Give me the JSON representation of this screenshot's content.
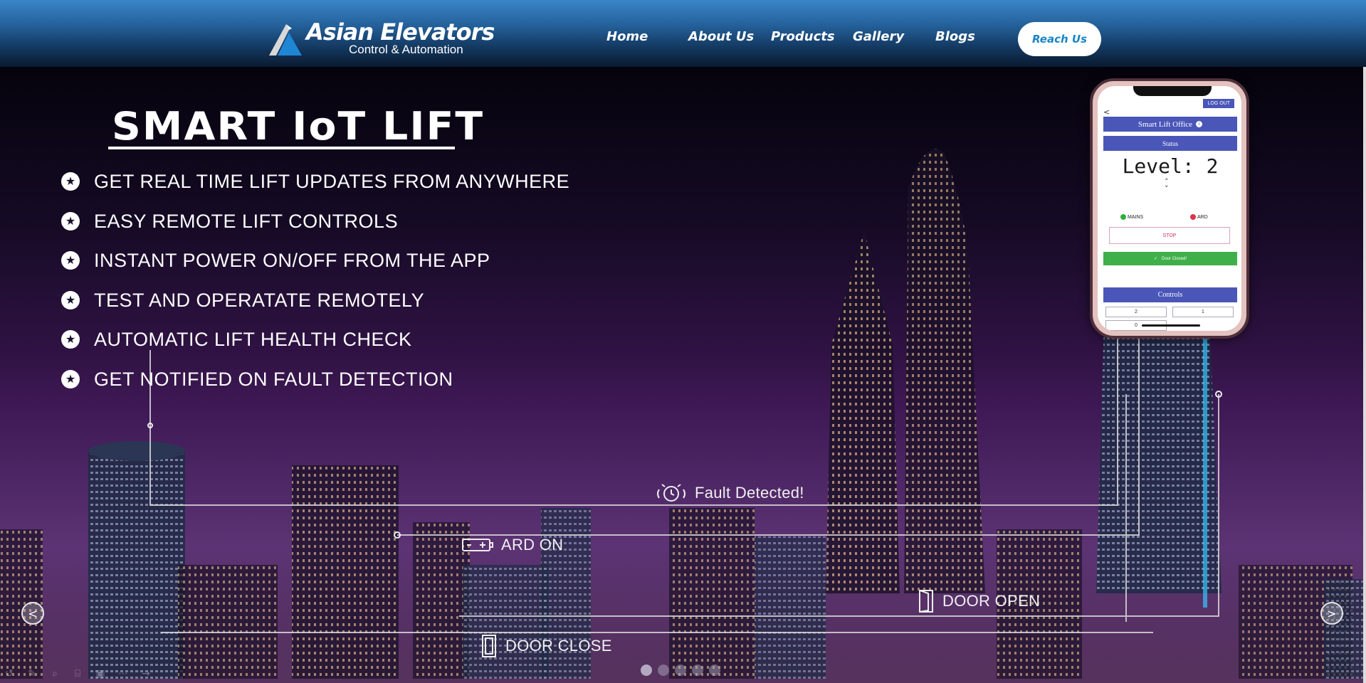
{
  "brand": {
    "name": "Asian Elevators",
    "tagline": "Control & Automation"
  },
  "nav": {
    "items": [
      {
        "label": "Home"
      },
      {
        "label": "About Us"
      },
      {
        "label": "Products"
      },
      {
        "label": "Gallery"
      },
      {
        "label": "Blogs"
      }
    ],
    "cta_label": "Reach Us"
  },
  "hero": {
    "title": "SMART IoT LIFT",
    "features": [
      "GET REAL TIME LIFT UPDATES FROM ANYWHERE",
      "EASY REMOTE LIFT CONTROLS",
      "INSTANT POWER ON/OFF FROM THE APP",
      "TEST AND OPERATATE REMOTELY",
      "AUTOMATIC LIFT HEALTH CHECK",
      "GET NOTIFIED ON FAULT DETECTION"
    ],
    "callouts": {
      "fault": "Fault Detected!",
      "ard": "ARD ON",
      "door_open": "DOOR OPEN",
      "door_close": "DOOR CLOSE"
    }
  },
  "phone": {
    "logout": "LOG OUT",
    "header": "Smart Lift Office",
    "status_label": "Status",
    "level": "Level: 2",
    "mains_label": "MAINS",
    "ard_label": "ARD",
    "stop_label": "STOP",
    "door_label": "Door Closed!",
    "controls_label": "Controls",
    "buttons": [
      "2",
      "1",
      "0"
    ]
  },
  "carousel": {
    "prev_label": "<",
    "next_label": ">",
    "slide_count": 5,
    "active_slide": 1
  },
  "colors": {
    "header_top": "#3a86c8",
    "header_bottom": "#0a1a30",
    "cta_text": "#1a86c4",
    "phone_accent": "#4a56b8",
    "door_ok": "#3fb049"
  }
}
